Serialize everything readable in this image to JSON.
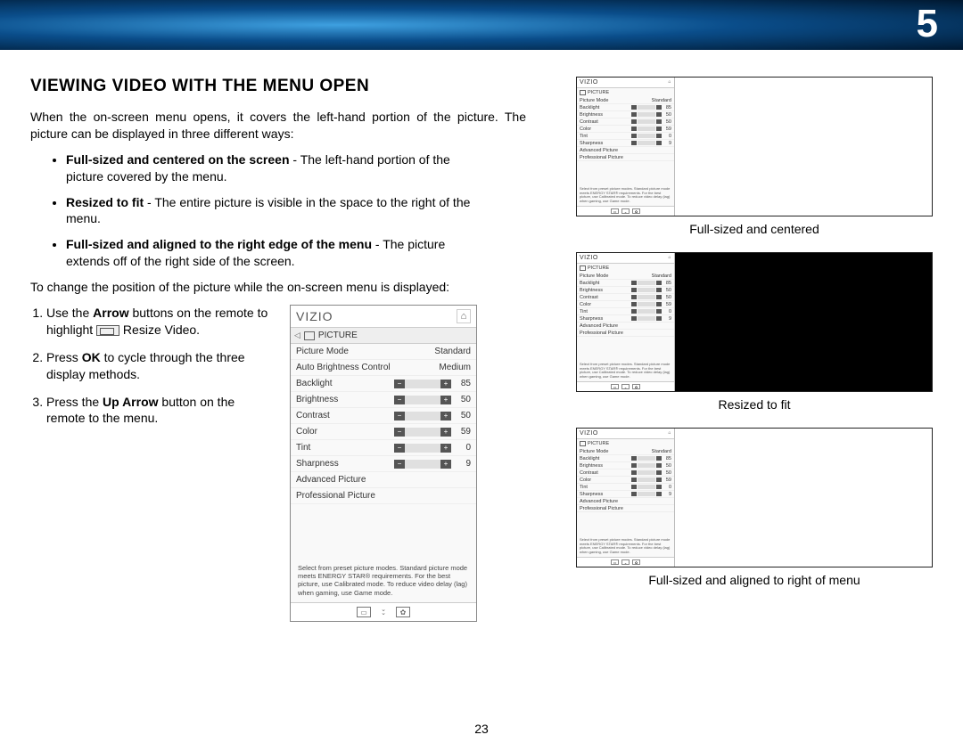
{
  "chapter": "5",
  "page_number": "23",
  "heading": "VIEWING VIDEO WITH THE MENU OPEN",
  "intro": "When the on-screen menu opens, it covers the left-hand portion of the picture. The picture can be displayed in three different ways:",
  "bullets": [
    {
      "bold": "Full-sized and centered on the screen",
      "rest": " - The left-hand portion of the picture covered by the menu."
    },
    {
      "bold": "Resized to fit",
      "rest": " - The entire picture is visible in the space to the right of the menu."
    },
    {
      "bold": "Full-sized and aligned to the right edge of the menu",
      "rest": " - The picture extends off of the right side of the screen."
    }
  ],
  "change_text": "To change the position of the picture while the on-screen menu is displayed:",
  "steps": {
    "s1a": "Use the ",
    "s1b": "Arrow",
    "s1c": " buttons on the remote to highlight ",
    "s1d": " Resize Video.",
    "s2a": "Press ",
    "s2b": "OK",
    "s2c": " to cycle through the three display methods.",
    "s3a": "Press the ",
    "s3b": "Up Arrow",
    "s3c": " button on the remote to the menu."
  },
  "menu": {
    "brand": "VIZIO",
    "section": "PICTURE",
    "rows": [
      {
        "label": "Picture Mode",
        "value": "Standard"
      },
      {
        "label": "Auto Brightness Control",
        "value": "Medium"
      }
    ],
    "sliders": [
      {
        "label": "Backlight",
        "value": "85"
      },
      {
        "label": "Brightness",
        "value": "50"
      },
      {
        "label": "Contrast",
        "value": "50"
      },
      {
        "label": "Color",
        "value": "59"
      },
      {
        "label": "Tint",
        "value": "0"
      },
      {
        "label": "Sharpness",
        "value": "9"
      }
    ],
    "extra": [
      "Advanced Picture",
      "Professional Picture"
    ],
    "help": "Select from preset picture modes. Standard picture mode meets ENERGY STAR® requirements. For the best picture, use Calibrated mode. To reduce video delay (lag) when gaming, use Game mode."
  },
  "captions": {
    "c1": "Full-sized and centered",
    "c2": "Resized to fit",
    "c3": "Full-sized and aligned to right of menu"
  }
}
